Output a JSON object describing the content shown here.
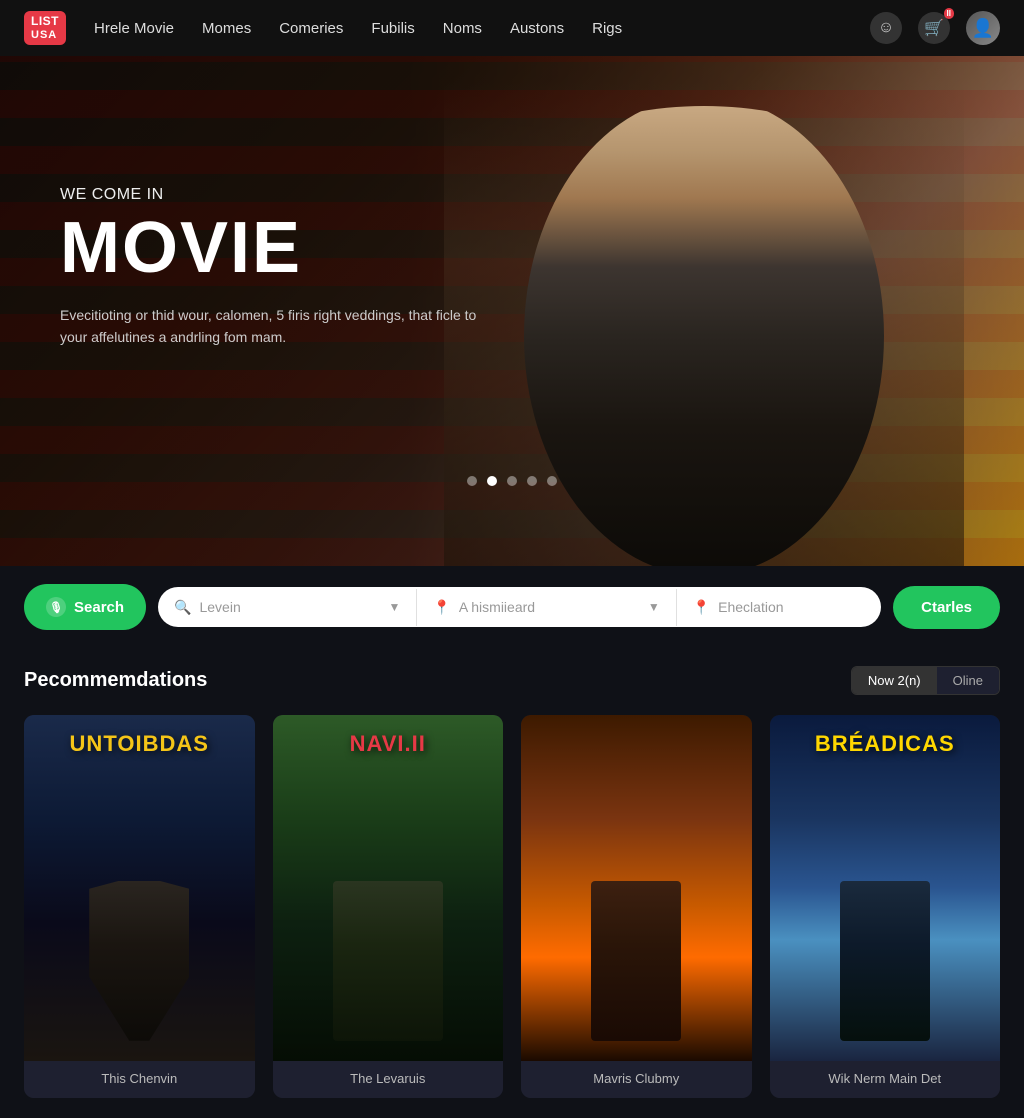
{
  "logo": {
    "top": "list",
    "bottom": "USA"
  },
  "navbar": {
    "links": [
      {
        "label": "Hrele Movie",
        "id": "nav-hrele-movie"
      },
      {
        "label": "Momes",
        "id": "nav-momes"
      },
      {
        "label": "Comeries",
        "id": "nav-comeries"
      },
      {
        "label": "Fubilis",
        "id": "nav-fubilis"
      },
      {
        "label": "Noms",
        "id": "nav-noms"
      },
      {
        "label": "Austons",
        "id": "nav-austons"
      },
      {
        "label": "Rigs",
        "id": "nav-rigs"
      }
    ]
  },
  "hero": {
    "subtitle": "WE COME IN",
    "title": "MOVIE",
    "description": "Evecitioting or thid wour, calomen, 5 firis right veddings, that ficle to your affelutines a andrling fom mam.",
    "dots": [
      {
        "active": false
      },
      {
        "active": true
      },
      {
        "active": false
      },
      {
        "active": false
      },
      {
        "active": false
      }
    ]
  },
  "search": {
    "button_label": "Search",
    "field1_placeholder": "Levein",
    "field2_placeholder": "A hismiieard",
    "field3_placeholder": "Eheclation",
    "go_button_label": "Ctarles"
  },
  "recommendations": {
    "section_title": "Pecommemdations",
    "filter_tabs": [
      {
        "label": "Now 2(n)",
        "active": true
      },
      {
        "label": "Oline",
        "active": false
      }
    ],
    "movies": [
      {
        "id": "movie-1",
        "title": "UNTOIBDAS",
        "title_color": "yellow",
        "subtitle": "This Chenvin",
        "poster_class": "poster-1"
      },
      {
        "id": "movie-2",
        "title": "NAVI.II",
        "title_color": "red",
        "subtitle": "The Levaruis",
        "poster_class": "poster-2"
      },
      {
        "id": "movie-3",
        "title": "",
        "title_color": "orange",
        "subtitle": "Mavris Clubmy",
        "poster_class": "poster-3"
      },
      {
        "id": "movie-4",
        "title": "BRÉADICAS",
        "title_color": "gold",
        "subtitle": "Wik Nerm Main Det",
        "poster_class": "poster-4"
      }
    ]
  }
}
